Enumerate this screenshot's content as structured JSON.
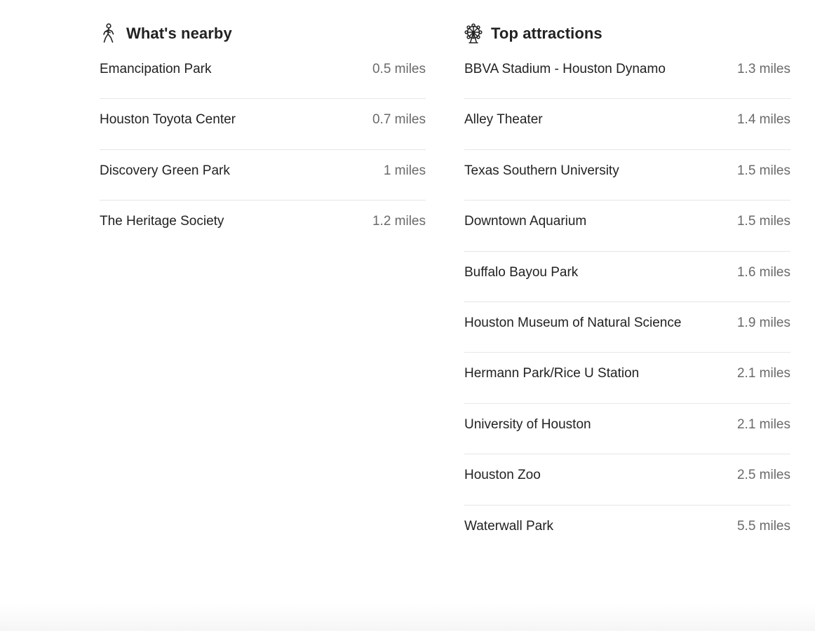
{
  "nearby": {
    "title": "What's nearby",
    "icon": "walking-person-icon",
    "items": [
      {
        "name": "Emancipation Park",
        "distance": "0.5 miles"
      },
      {
        "name": "Houston Toyota Center",
        "distance": "0.7 miles"
      },
      {
        "name": "Discovery Green Park",
        "distance": "1 miles"
      },
      {
        "name": "The Heritage Society",
        "distance": "1.2 miles"
      }
    ]
  },
  "attractions": {
    "title": "Top attractions",
    "icon": "ferris-wheel-icon",
    "items": [
      {
        "name": "BBVA Stadium - Houston Dynamo",
        "distance": "1.3 miles"
      },
      {
        "name": "Alley Theater",
        "distance": "1.4 miles"
      },
      {
        "name": "Texas Southern University",
        "distance": "1.5 miles"
      },
      {
        "name": "Downtown Aquarium",
        "distance": "1.5 miles"
      },
      {
        "name": "Buffalo Bayou Park",
        "distance": "1.6 miles"
      },
      {
        "name": "Houston Museum of Natural Science",
        "distance": "1.9 miles"
      },
      {
        "name": "Hermann Park/Rice U Station",
        "distance": "2.1 miles"
      },
      {
        "name": "University of Houston",
        "distance": "2.1 miles"
      },
      {
        "name": "Houston Zoo",
        "distance": "2.5 miles"
      },
      {
        "name": "Waterwall Park",
        "distance": "5.5 miles"
      }
    ]
  },
  "colors": {
    "text": "#222222",
    "distance_text": "#6a6a6a",
    "divider": "#e6e6e6"
  }
}
